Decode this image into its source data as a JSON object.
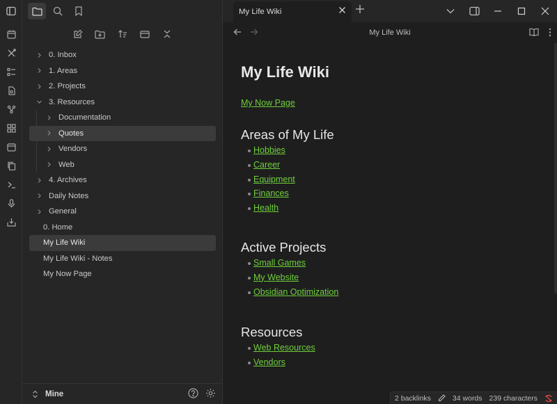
{
  "sidebar": {
    "tree": [
      {
        "label": "0. Inbox",
        "type": "folder",
        "expanded": false
      },
      {
        "label": "1. Areas",
        "type": "folder",
        "expanded": false
      },
      {
        "label": "2. Projects",
        "type": "folder",
        "expanded": false
      },
      {
        "label": "3. Resources",
        "type": "folder",
        "expanded": true
      },
      {
        "label": "Documentation",
        "type": "folder",
        "expanded": false
      },
      {
        "label": "Quotes",
        "type": "folder",
        "expanded": false
      },
      {
        "label": "Vendors",
        "type": "folder",
        "expanded": false
      },
      {
        "label": "Web",
        "type": "folder",
        "expanded": false
      },
      {
        "label": "4. Archives",
        "type": "folder",
        "expanded": false
      },
      {
        "label": "Daily Notes",
        "type": "folder",
        "expanded": false
      },
      {
        "label": "General",
        "type": "folder",
        "expanded": false
      },
      {
        "label": "0. Home",
        "type": "file"
      },
      {
        "label": "My Life Wiki",
        "type": "file",
        "selected": true
      },
      {
        "label": "My Life Wiki - Notes",
        "type": "file"
      },
      {
        "label": "My Now Page",
        "type": "file"
      }
    ],
    "vault_name": "Mine"
  },
  "tab": {
    "title": "My Life Wiki"
  },
  "view": {
    "title": "My Life Wiki"
  },
  "note": {
    "h1": "My Life Wiki",
    "now_link": "My Now Page",
    "areas": {
      "heading": "Areas of My Life",
      "items": [
        "Hobbies",
        "Career",
        "Equipment",
        "Finances",
        "Health"
      ]
    },
    "projects": {
      "heading": "Active Projects",
      "items": [
        "Small Games",
        "My Website",
        "Obsidian Optimization"
      ]
    },
    "resources": {
      "heading": "Resources",
      "items": [
        "Web Resources",
        "Vendors"
      ]
    }
  },
  "status": {
    "backlinks": "2 backlinks",
    "words": "34 words",
    "characters": "239 characters"
  },
  "colors": {
    "link": "#6fcf3c",
    "background": "#1e1e1e",
    "panel": "#262626",
    "sync_error": "#e04a4a"
  }
}
